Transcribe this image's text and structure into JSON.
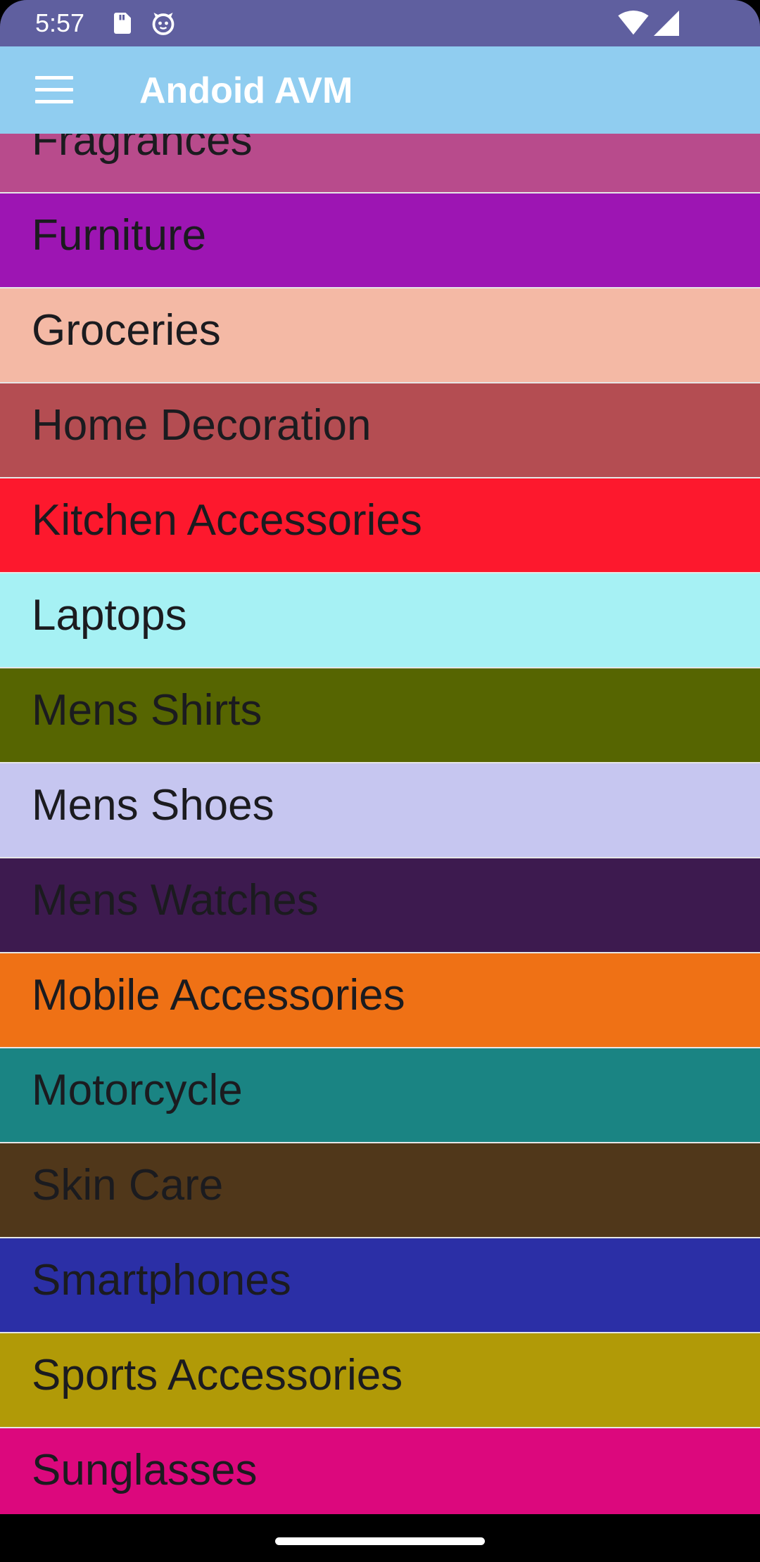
{
  "status_bar": {
    "time": "5:57",
    "color": "#5f5f9f",
    "icons": [
      "sd-card-icon",
      "face-icon",
      "wifi-icon",
      "cell-signal-icon"
    ]
  },
  "app_bar": {
    "title": "Andoid AVM",
    "color": "#90cdf0",
    "menu_icon": "hamburger-menu-icon"
  },
  "categories": [
    {
      "label": "Fragrances",
      "color": "#b84b8c"
    },
    {
      "label": "Furniture",
      "color": "#9d15b3"
    },
    {
      "label": "Groceries",
      "color": "#f4b9a5"
    },
    {
      "label": "Home Decoration",
      "color": "#b44d52"
    },
    {
      "label": "Kitchen Accessories",
      "color": "#fd182d"
    },
    {
      "label": "Laptops",
      "color": "#a6f1f4"
    },
    {
      "label": "Mens Shirts",
      "color": "#566501"
    },
    {
      "label": "Mens Shoes",
      "color": "#c6c6f0"
    },
    {
      "label": "Mens Watches",
      "color": "#3d1a4f"
    },
    {
      "label": "Mobile Accessories",
      "color": "#ef7115"
    },
    {
      "label": "Motorcycle",
      "color": "#1a8483"
    },
    {
      "label": "Skin Care",
      "color": "#50371a"
    },
    {
      "label": "Smartphones",
      "color": "#2b2fa6"
    },
    {
      "label": "Sports Accessories",
      "color": "#b19a07"
    },
    {
      "label": "Sunglasses",
      "color": "#dc087d"
    }
  ]
}
